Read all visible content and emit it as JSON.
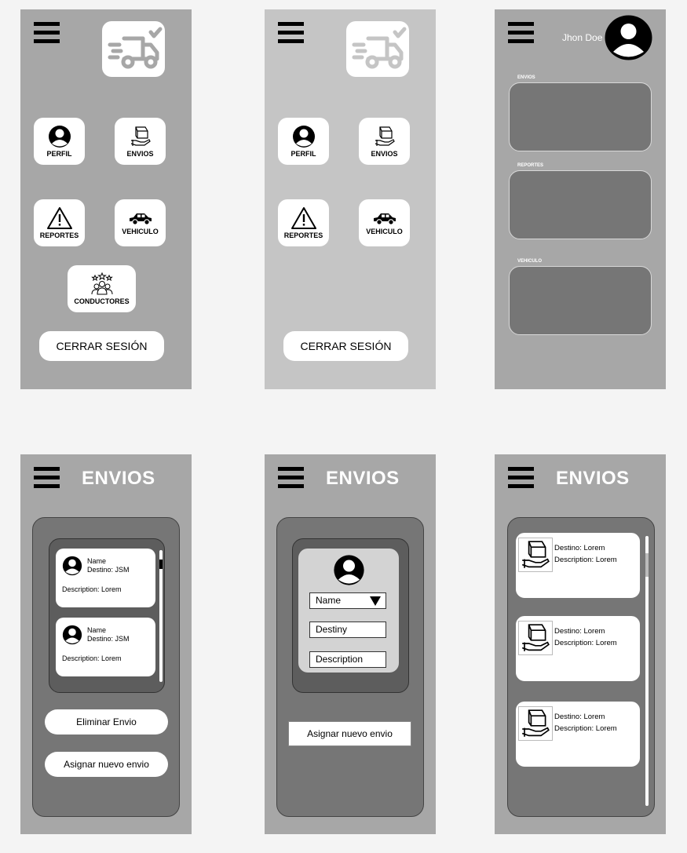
{
  "screen_menu_admin": {
    "tiles": {
      "perfil": "PERFIL",
      "envios": "ENVIOS",
      "reportes": "REPORTES",
      "vehiculo": "VEHICULO",
      "conductores": "CONDUCTORES"
    },
    "logout_label": "CERRAR SESIÓN"
  },
  "screen_menu_driver": {
    "tiles": {
      "perfil": "PERFIL",
      "envios": "ENVIOS",
      "reportes": "REPORTES",
      "vehiculo": "VEHICULO"
    },
    "logout_label": "CERRAR SESIÓN"
  },
  "screen_profile": {
    "user_name": "Jhon Doe",
    "sections": [
      "ENVIOS",
      "REPORTES",
      "VEHICULO"
    ]
  },
  "screen_envios_list": {
    "title": "ENVIOS",
    "cards": [
      {
        "name": "Name",
        "destino": "Destino: JSM",
        "description": "Description: Lorem"
      },
      {
        "name": "Name",
        "destino": "Destino: JSM",
        "description": "Description: Lorem"
      }
    ],
    "delete_label": "Eliminar Envio",
    "assign_label": "Asignar nuevo envio"
  },
  "screen_envios_assign": {
    "title": "ENVIOS",
    "name_select": "Name",
    "destiny_field": "Destiny",
    "description_field": "Description",
    "assign_label": "Asignar nuevo envio"
  },
  "screen_envios_driver": {
    "title": "ENVIOS",
    "cards": [
      {
        "destino": "Destino: Lorem",
        "description": "Description: Lorem"
      },
      {
        "destino": "Destino: Lorem",
        "description": "Description: Lorem"
      },
      {
        "destino": "Destino: Lorem",
        "description": "Description: Lorem"
      }
    ]
  },
  "icons": [
    "menu-icon",
    "truck-logo-icon",
    "user-icon",
    "package-hand-icon",
    "warning-icon",
    "car-icon",
    "team-stars-icon",
    "dropdown-arrow-icon"
  ],
  "colors": {
    "screen_gray": "#a7a7a7",
    "light_gray": "#c5c5c5",
    "panel_gray": "#767676",
    "white": "#ffffff"
  }
}
